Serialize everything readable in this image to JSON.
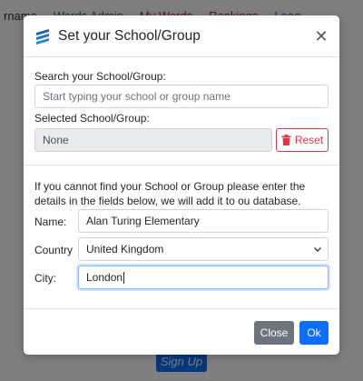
{
  "background": {
    "nav_items": [
      "rname",
      "Words Admin",
      "My Words",
      "Rankings",
      "Leag"
    ],
    "signup_label": "Sign Up"
  },
  "modal": {
    "title": "Set your School/Group",
    "search": {
      "label": "Search your School/Group:",
      "placeholder": "Start typing your school or group name",
      "value": ""
    },
    "selected": {
      "label": "Selected School/Group:",
      "value": "None",
      "reset_label": "Reset"
    },
    "info_text": "If you cannot find your School or Group please enter the details in the fields below, we will add it to ou database.",
    "fields": {
      "name_label": "Name:",
      "name_value": "Alan Turing Elementary",
      "country_label": "Country",
      "country_value": "United Kingdom",
      "city_label": "City:",
      "city_value": "London"
    },
    "footer": {
      "close_label": "Close",
      "ok_label": "Ok"
    }
  },
  "colors": {
    "primary": "#0d6efd",
    "secondary": "#6c757d",
    "danger": "#dc3545",
    "readonly_bg": "#e9ecef"
  },
  "icons": {
    "logo": "brand-logo-icon",
    "close": "close-icon",
    "reset": "trash-icon",
    "select": "chevron-down-icon"
  }
}
